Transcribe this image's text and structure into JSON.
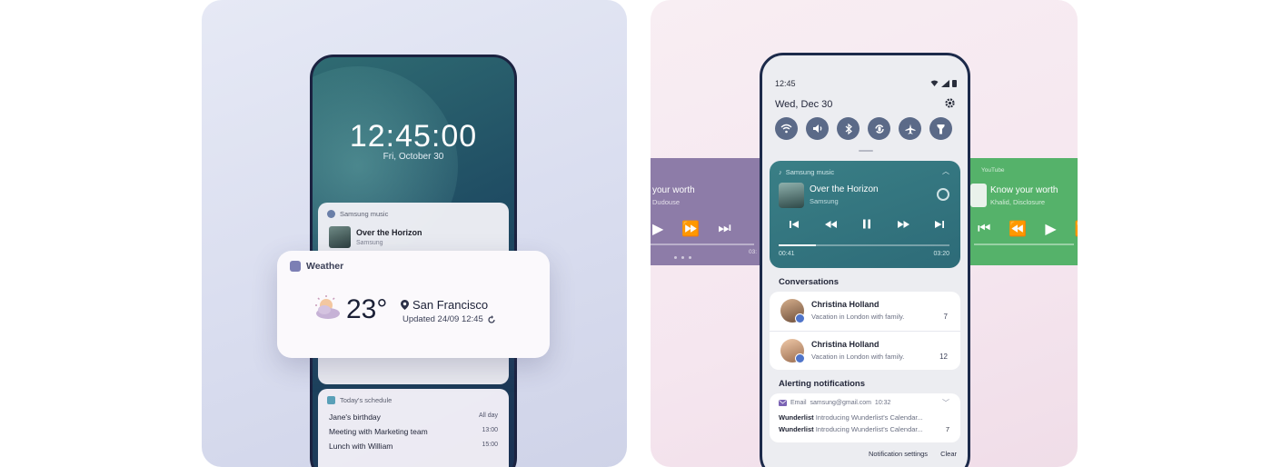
{
  "lock_screen": {
    "time": "12:45:00",
    "date": "Fri, October 30",
    "music_card": {
      "app": "Samsung music",
      "title": "Over the Horizon",
      "artist": "Samsung"
    },
    "weather_card": {
      "app": "Weather",
      "temperature": "23°",
      "location": "San Francisco",
      "updated": "Updated 24/09 12:45"
    },
    "schedule_card": {
      "app": "Today's schedule",
      "events": [
        {
          "title": "Jane's birthday",
          "time": "All day"
        },
        {
          "title": "Meeting with Marketing team",
          "time": "13:00"
        },
        {
          "title": "Lunch with William",
          "time": "15:00"
        }
      ]
    }
  },
  "quick_panel": {
    "status_time": "12:45",
    "date": "Wed, Dec 30",
    "tiles": [
      "wifi-icon",
      "sound-icon",
      "bluetooth-icon",
      "auto-rotate-icon",
      "airplane-mode-icon",
      "flashlight-icon"
    ],
    "player": {
      "app": "Samsung music",
      "title": "Over the Horizon",
      "artist": "Samsung",
      "elapsed": "00:41",
      "duration": "03:20",
      "progress": 0.22
    },
    "conversations_label": "Conversations",
    "conversations": [
      {
        "name": "Christina Holland",
        "message": "Vacation in London with family.",
        "count": "7"
      },
      {
        "name": "Christina Holland",
        "message": "Vacation in London with family.",
        "count": "12"
      }
    ],
    "alerting_label": "Alerting notifications",
    "email": {
      "app": "Email",
      "account": "samsung@gmail.com",
      "time": "10:32",
      "rows": [
        {
          "sender": "Wunderlist",
          "text": "Introducing Wunderlist's Calendar...",
          "count": ""
        },
        {
          "sender": "Wunderlist",
          "text": "Introducing Wunderlist's Calendar...",
          "count": "7"
        }
      ]
    },
    "footer": {
      "settings": "Notification settings",
      "clear": "Clear"
    },
    "side_left": {
      "title": "your worth",
      "sub": "Dudouse",
      "time": "03:"
    },
    "side_right": {
      "app": "YouTube",
      "title": "Know your worth",
      "sub": "Khalid, Disclosure"
    }
  },
  "colors": {
    "left_panel_bg": "#dfe2f2",
    "right_panel_bg": "#f6e8f0",
    "player_bg": "#337583",
    "purple_card": "#8d7ca8",
    "green_card": "#55b26a"
  }
}
